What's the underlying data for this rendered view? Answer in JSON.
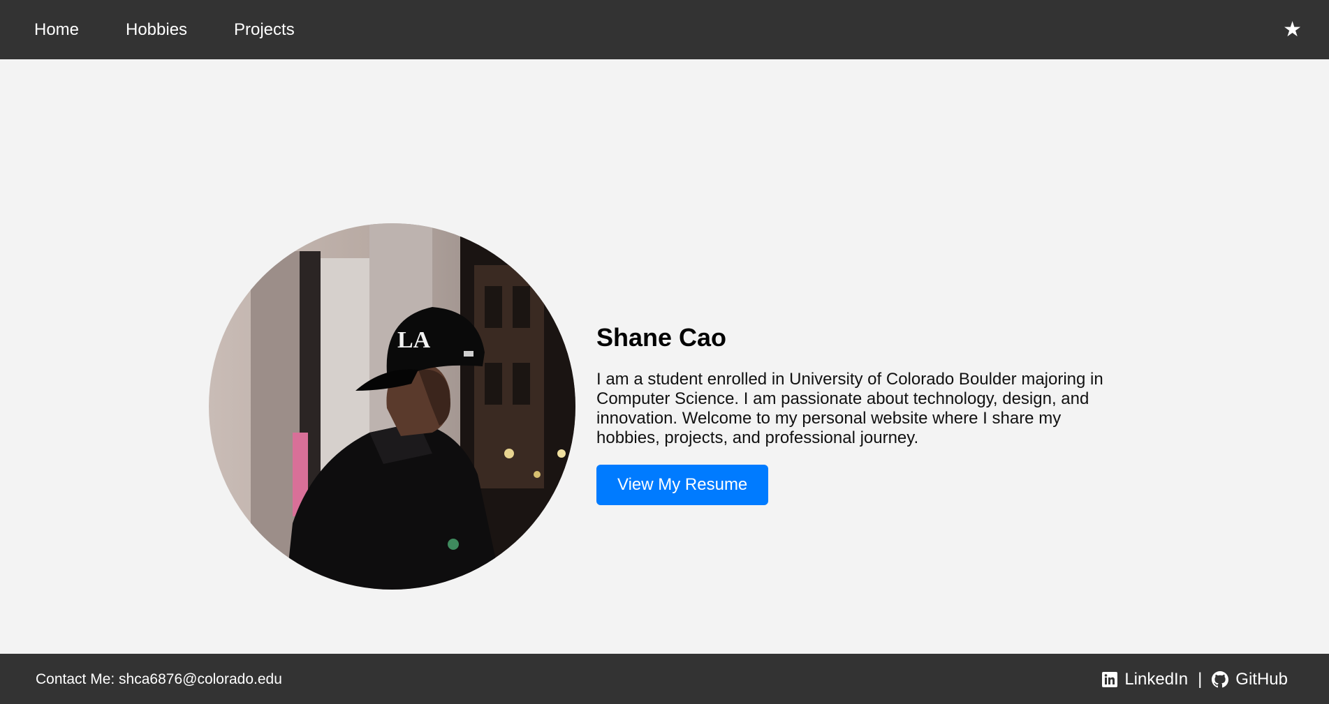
{
  "nav": {
    "links": [
      "Home",
      "Hobbies",
      "Projects"
    ],
    "theme_toggle_icon": "star-icon",
    "theme_toggle_glyph": "★"
  },
  "hero": {
    "name": "Shane Cao",
    "bio": "I am a student enrolled in University of Colorado Boulder majoring in Computer Science. I am passionate about technology, design, and innovation. Welcome to my personal website where I share my hobbies, projects, and professional journey.",
    "resume_button": "View My Resume"
  },
  "footer": {
    "contact": "Contact Me: shca6876@colorado.edu",
    "linkedin": "LinkedIn",
    "separator": "|",
    "github": "GitHub"
  },
  "colors": {
    "nav_bg": "#333333",
    "page_bg": "#f3f3f3",
    "accent": "#007bff",
    "text": "#000000"
  }
}
